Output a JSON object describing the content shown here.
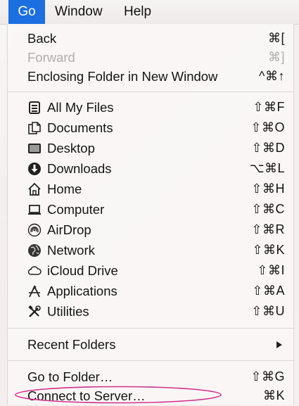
{
  "menubar": {
    "items": [
      {
        "label": "Go",
        "active": true
      },
      {
        "label": "Window"
      },
      {
        "label": "Help"
      }
    ]
  },
  "menu": {
    "group1": [
      {
        "label": "Back",
        "shortcut": "⌘[",
        "enabled": true
      },
      {
        "label": "Forward",
        "shortcut": "⌘]",
        "enabled": false
      },
      {
        "label": "Enclosing Folder in New Window",
        "shortcut": "^⌘↑",
        "enabled": true
      }
    ],
    "places": [
      {
        "label": "All My Files",
        "shortcut": "⇧⌘F",
        "icon": "all-my-files-icon"
      },
      {
        "label": "Documents",
        "shortcut": "⇧⌘O",
        "icon": "documents-icon"
      },
      {
        "label": "Desktop",
        "shortcut": "⇧⌘D",
        "icon": "desktop-icon"
      },
      {
        "label": "Downloads",
        "shortcut": "⌥⌘L",
        "icon": "downloads-icon"
      },
      {
        "label": "Home",
        "shortcut": "⇧⌘H",
        "icon": "home-icon"
      },
      {
        "label": "Computer",
        "shortcut": "⇧⌘C",
        "icon": "computer-icon"
      },
      {
        "label": "AirDrop",
        "shortcut": "⇧⌘R",
        "icon": "airdrop-icon"
      },
      {
        "label": "Network",
        "shortcut": "⇧⌘K",
        "icon": "network-icon"
      },
      {
        "label": "iCloud Drive",
        "shortcut": "⇧⌘I",
        "icon": "icloud-icon"
      },
      {
        "label": "Applications",
        "shortcut": "⇧⌘A",
        "icon": "applications-icon"
      },
      {
        "label": "Utilities",
        "shortcut": "⇧⌘U",
        "icon": "utilities-icon"
      }
    ],
    "recent": {
      "label": "Recent Folders"
    },
    "group4": [
      {
        "label": "Go to Folder…",
        "shortcut": "⇧⌘G"
      },
      {
        "label": "Connect to Server…",
        "shortcut": "⌘K"
      }
    ]
  },
  "colors": {
    "menubar_active": "#1b6fe0",
    "annotation_circle": "#d2308a"
  }
}
